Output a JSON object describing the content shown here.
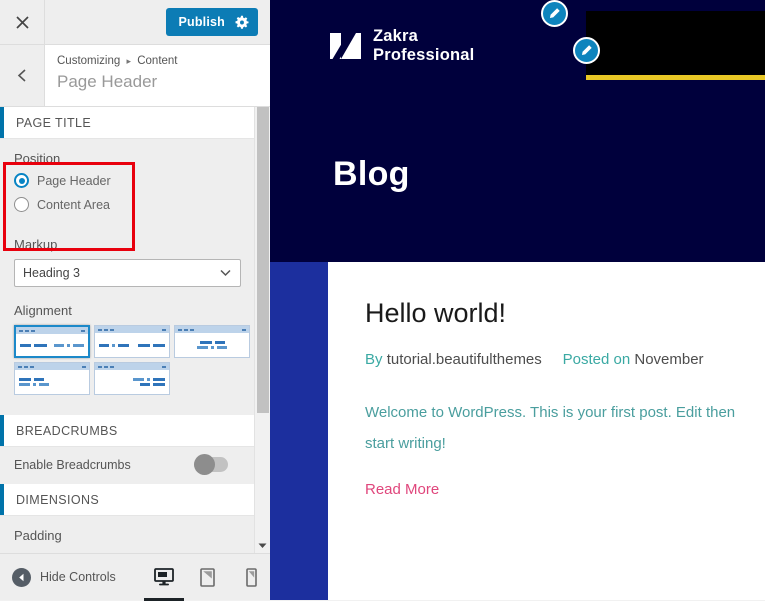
{
  "customizer": {
    "close_label": "×",
    "close_icon": "close-icon",
    "publish_label": "Publish",
    "gear_icon": "gear-icon",
    "back_icon": "chevron-left-icon",
    "breadcrumb": {
      "root": "Customizing",
      "separator": "▸",
      "parent": "Content"
    },
    "panel_title": "Page Header",
    "accent_color": "#0073aa",
    "publish_button_color": "#0c7cb5",
    "highlight_color": "#e8000d"
  },
  "sections": {
    "page_title": {
      "heading": "PAGE TITLE",
      "position": {
        "label": "Position",
        "options": [
          {
            "label": "Page Header",
            "selected": true
          },
          {
            "label": "Content Area",
            "selected": false
          }
        ]
      },
      "markup": {
        "label": "Markup",
        "value": "Heading 3",
        "chevron_icon": "chevron-down-icon"
      },
      "alignment": {
        "label": "Alignment",
        "options": [
          {
            "name": "title-left-meta-right",
            "selected": true
          },
          {
            "name": "title-left-meta-far-right",
            "selected": false
          },
          {
            "name": "centered",
            "selected": false
          },
          {
            "name": "stacked-left",
            "selected": false
          },
          {
            "name": "stacked-right",
            "selected": false
          }
        ]
      }
    },
    "breadcrumbs": {
      "heading": "BREADCRUMBS",
      "enable": {
        "label": "Enable Breadcrumbs",
        "value": "off"
      }
    },
    "dimensions": {
      "heading": "DIMENSIONS",
      "padding_label": "Padding"
    }
  },
  "footer": {
    "hide_controls_label": "Hide Controls",
    "hide_controls_icon": "collapse-arrow-icon",
    "devices": [
      {
        "name": "desktop",
        "icon": "desktop-icon",
        "active": true
      },
      {
        "name": "tablet",
        "icon": "tablet-icon",
        "active": false
      },
      {
        "name": "mobile",
        "icon": "mobile-icon",
        "active": false
      }
    ]
  },
  "preview": {
    "header_bg": "#00003c",
    "body_bg": "#1c2f9e",
    "logo": {
      "icon": "zakra-logo-mark",
      "line1": "Zakra",
      "line2": "Professional"
    },
    "edit_shortcuts": [
      {
        "name": "edit-shortcut-header"
      },
      {
        "name": "edit-shortcut-logo"
      },
      {
        "name": "edit-shortcut-menu"
      }
    ],
    "banner": {
      "name": "black-banner",
      "bg": "#000000",
      "underline_color": "#e8c725"
    },
    "page_title": "Blog",
    "post": {
      "title": "Hello world!",
      "meta_by_prefix": "By",
      "meta_author": "tutorial.beautifulthemes",
      "meta_posted_prefix": "Posted on",
      "meta_date": "November",
      "excerpt": "Welcome to WordPress. This is your first post. Edit then start writing!",
      "read_more": "Read More",
      "read_more_color": "#e0467c",
      "link_color": "#4a9e9e"
    }
  }
}
